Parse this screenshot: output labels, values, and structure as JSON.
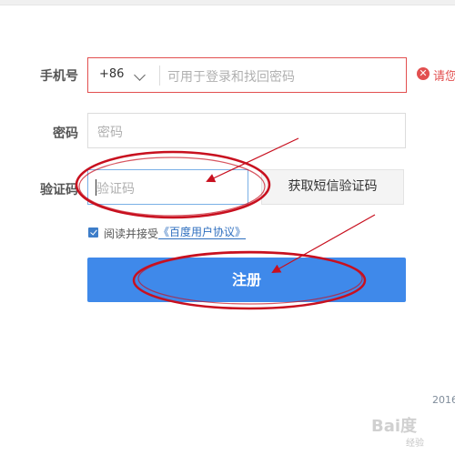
{
  "form": {
    "phone": {
      "label": "手机号",
      "country_code": "+86",
      "placeholder": "可用于登录和找回密码",
      "error_text": "请您"
    },
    "password": {
      "label": "密码",
      "placeholder": "密码"
    },
    "captcha": {
      "label": "验证码",
      "placeholder": "验证码",
      "get_code_label": "获取短信验证码"
    },
    "agreement": {
      "checked": true,
      "text": "阅读并接受",
      "link": "《百度用户协议》"
    },
    "register_label": "注册"
  },
  "footer": {
    "year": "2016"
  },
  "watermark": {
    "brand": "Bai度",
    "subtext": "经验"
  },
  "colors": {
    "error": "#e24f4f",
    "primary_button": "#3f89ea",
    "link": "#2f6fbf",
    "annotation": "#d0021b"
  }
}
